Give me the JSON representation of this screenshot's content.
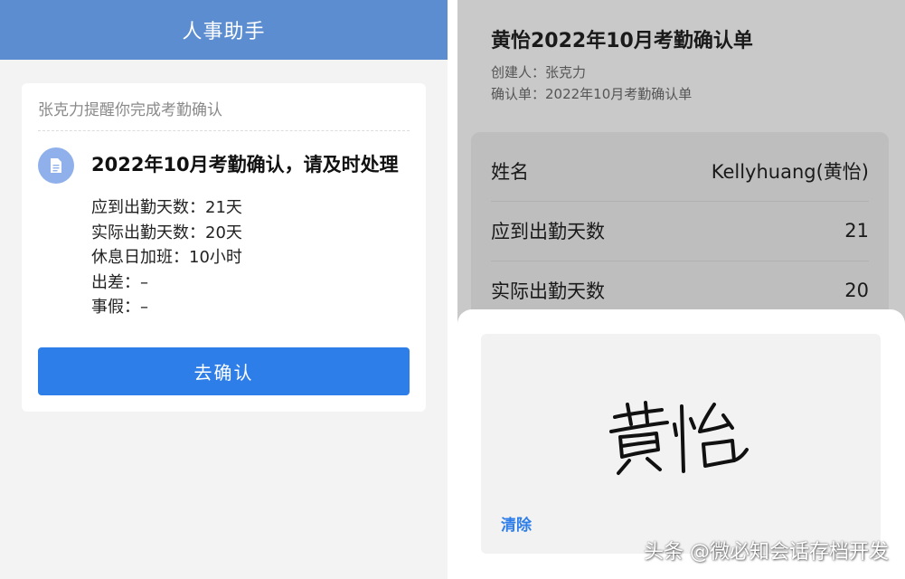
{
  "left_panel": {
    "header_title": "人事助手",
    "card": {
      "reminder": "张克力提醒你完成考勤确认",
      "icon": "document-icon",
      "heading": "2022年10月考勤确认，请及时处理",
      "details": [
        "应到出勤天数：21天",
        "实际出勤天数：20天",
        "休息日加班：10小时",
        "出差：–",
        "事假：–"
      ],
      "confirm_button": "去确认"
    },
    "colors": {
      "header": "#5b8dd0",
      "button": "#2e7ee9",
      "icon": "#8fb0ea"
    }
  },
  "right_panel": {
    "title": "黄怡2022年10月考勤确认单",
    "creator": "创建人：张克力",
    "form_name": "确认单：2022年10月考勤确认单",
    "rows": [
      {
        "label": "姓名",
        "value": "Kellyhuang(黄怡)"
      },
      {
        "label": "应到出勤天数",
        "value": "21"
      },
      {
        "label": "实际出勤天数",
        "value": "20"
      }
    ],
    "signature_pad": {
      "signature_text": "黄怡",
      "clear_button": "清除"
    }
  },
  "watermark": "头条 @微必知会话存档开发"
}
